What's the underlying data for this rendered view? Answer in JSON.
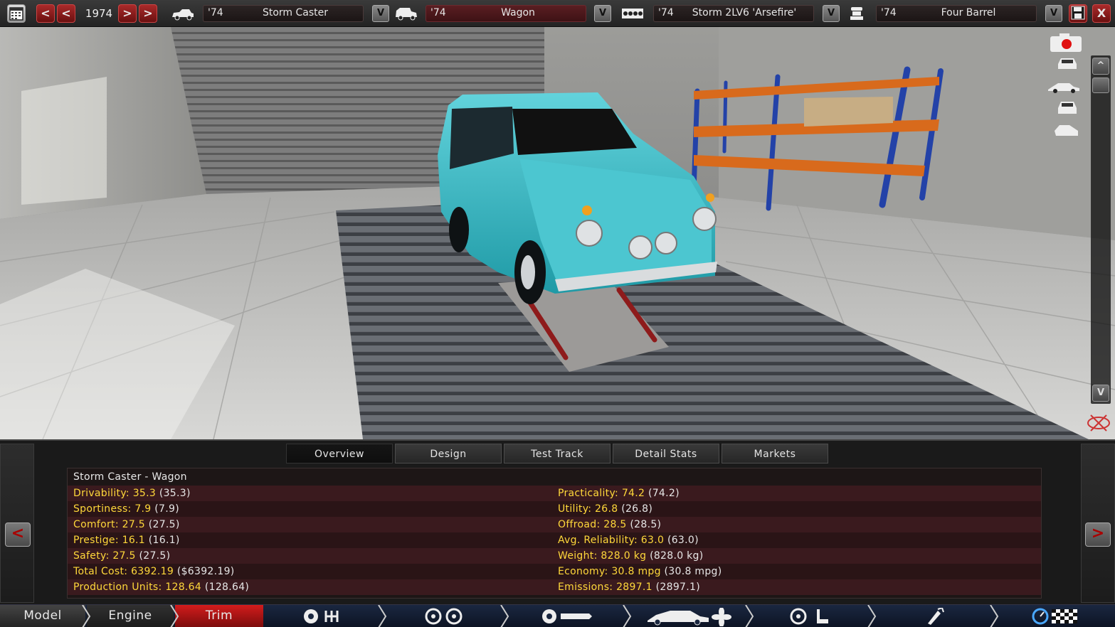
{
  "toolbar": {
    "year": "1974",
    "prev_fast": "<",
    "prev": "<",
    "next": ">",
    "next_fast": ">",
    "dropdown_glyph": "V",
    "close_glyph": "X",
    "selectors": [
      {
        "year": "'74",
        "name": "Storm Caster",
        "icon": "car-model-icon"
      },
      {
        "year": "'74",
        "name": "Wagon",
        "icon": "car-body-icon"
      },
      {
        "year": "'74",
        "name": "Storm 2LV6 'Arsefire'",
        "icon": "engine-icon"
      },
      {
        "year": "'74",
        "name": "Four Barrel",
        "icon": "carburetor-icon"
      }
    ],
    "colors": {
      "accent_red": "#b02020",
      "selector_red": "#5a1e22"
    }
  },
  "viewtools": {
    "icons": [
      "camera-record-icon",
      "car-front-view-icon",
      "car-side-view-icon",
      "car-rear-view-icon",
      "car-angle-view-icon",
      "orbit-reset-icon"
    ],
    "scroll_up": "^",
    "scroll_down": "V"
  },
  "car": {
    "paint_color": "#38b9c4"
  },
  "panel": {
    "tabs": [
      "Overview",
      "Design",
      "Test Track",
      "Detail Stats",
      "Markets"
    ],
    "active_tab": "Overview",
    "prev_label": "<",
    "next_label": ">",
    "title": "Storm Caster - Wagon",
    "left_stats": [
      {
        "label": "Drivability:",
        "value": "35.3",
        "paren": "(35.3)"
      },
      {
        "label": "Sportiness:",
        "value": "7.9",
        "paren": "(7.9)"
      },
      {
        "label": "Comfort:",
        "value": "27.5",
        "paren": "(27.5)"
      },
      {
        "label": "Prestige:",
        "value": "16.1",
        "paren": "(16.1)"
      },
      {
        "label": "Safety:",
        "value": "27.5",
        "paren": "(27.5)"
      },
      {
        "label": "Total Cost:",
        "value": "6392.19",
        "paren": "($6392.19)"
      },
      {
        "label": "Production Units:",
        "value": "128.64",
        "paren": "(128.64)"
      }
    ],
    "right_stats": [
      {
        "label": "Practicality:",
        "value": "74.2",
        "paren": "(74.2)"
      },
      {
        "label": "Utility:",
        "value": "26.8",
        "paren": "(26.8)"
      },
      {
        "label": "Offroad:",
        "value": "28.5",
        "paren": "(28.5)"
      },
      {
        "label": "Avg. Reliability:",
        "value": "63.0",
        "paren": "(63.0)"
      },
      {
        "label": "Weight:",
        "value": "828.0 kg",
        "paren": "(828.0 kg)"
      },
      {
        "label": "Economy:",
        "value": "30.8 mpg",
        "paren": "(30.8 mpg)"
      },
      {
        "label": "Emissions:",
        "value": "2897.1",
        "paren": "(2897.1)"
      }
    ]
  },
  "bottom_nav": {
    "model": "Model",
    "engine": "Engine",
    "trim": "Trim",
    "icons": [
      "gearbox-icon",
      "wheels-icon",
      "brakes-suspension-icon",
      "aero-cooling-icon",
      "interior-icon",
      "fuel-system-icon",
      "test-drive-icon"
    ]
  }
}
